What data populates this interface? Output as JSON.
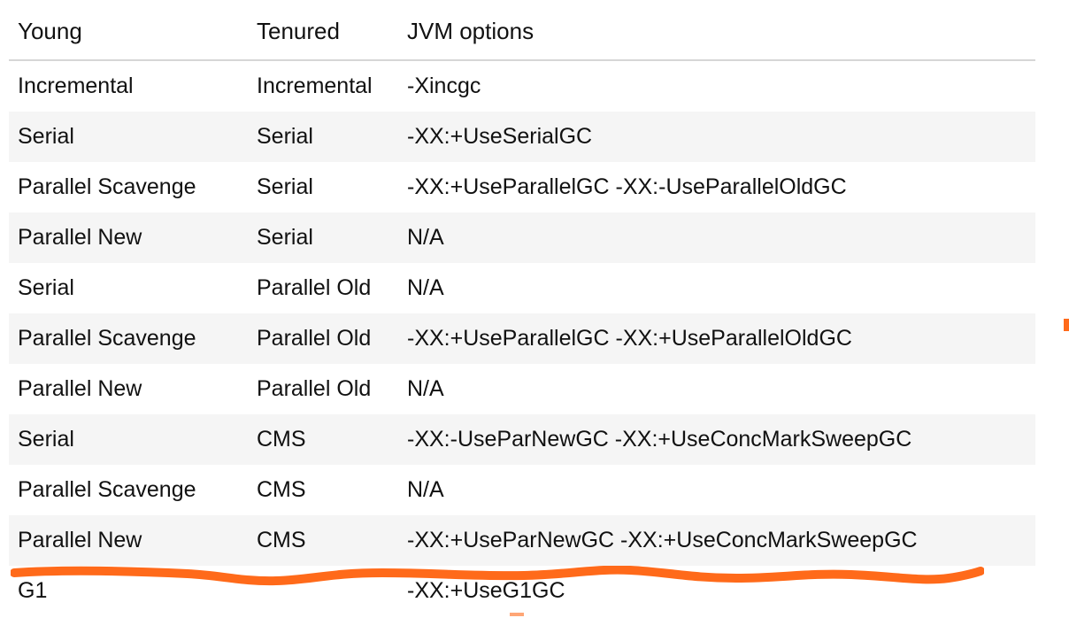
{
  "table": {
    "headers": {
      "young": "Young",
      "tenured": "Tenured",
      "jvm_options": "JVM options"
    },
    "rows": [
      {
        "young": "Incremental",
        "tenured": "Incremental",
        "opts": "-Xincgc"
      },
      {
        "young": "Serial",
        "tenured": "Serial",
        "opts": "-XX:+UseSerialGC"
      },
      {
        "young": "Parallel Scavenge",
        "tenured": "Serial",
        "opts": "-XX:+UseParallelGC -XX:-UseParallelOldGC"
      },
      {
        "young": "Parallel New",
        "tenured": "Serial",
        "opts": "N/A"
      },
      {
        "young": "Serial",
        "tenured": "Parallel Old",
        "opts": "N/A"
      },
      {
        "young": "Parallel Scavenge",
        "tenured": "Parallel Old",
        "opts": "-XX:+UseParallelGC -XX:+UseParallelOldGC"
      },
      {
        "young": "Parallel New",
        "tenured": "Parallel Old",
        "opts": "N/A"
      },
      {
        "young": "Serial",
        "tenured": "CMS",
        "opts": "-XX:-UseParNewGC -XX:+UseConcMarkSweepGC"
      },
      {
        "young": "Parallel Scavenge",
        "tenured": "CMS",
        "opts": "N/A"
      },
      {
        "young": "Parallel New",
        "tenured": "CMS",
        "opts": "-XX:+UseParNewGC -XX:+UseConcMarkSweepGC"
      },
      {
        "young": "G1",
        "tenured": "",
        "opts": "-XX:+UseG1GC"
      }
    ]
  },
  "annotation": {
    "highlight_row_index": 9,
    "color": "#ff6a1a"
  }
}
